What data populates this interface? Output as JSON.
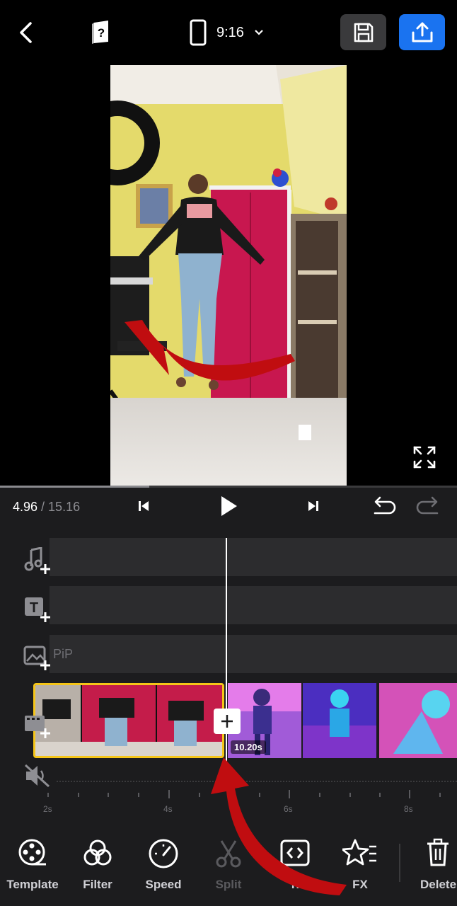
{
  "topbar": {
    "back_icon": "back-arrow-icon",
    "help_icon": "help-book-icon",
    "aspect_ratio": "9:16",
    "save_icon": "save-icon",
    "export_icon": "export-upload-icon",
    "export_color": "#1a73f0"
  },
  "preview": {
    "fullscreen_icon": "fullscreen-icon",
    "annotation_arrow_color": "#c00d10"
  },
  "playback": {
    "current_time": "4.96",
    "separator_total": " / 15.16",
    "progress": 0.327
  },
  "tracks": {
    "pip_label": "PiP",
    "video_clip_duration": "10.20s"
  },
  "ruler": [
    "2s",
    "4s",
    "6s",
    "8s"
  ],
  "toolbar": {
    "items": [
      {
        "label": "Template",
        "icon": "template-reel-icon"
      },
      {
        "label": "Filter",
        "icon": "filter-circles-icon"
      },
      {
        "label": "Speed",
        "icon": "speedometer-icon"
      },
      {
        "label": "Split",
        "icon": "scissors-icon"
      },
      {
        "label": "Tr",
        "icon": "trim-brackets-icon"
      },
      {
        "label": "FX",
        "icon": "fx-star-icon"
      },
      {
        "label": "Delete",
        "icon": "trash-icon"
      }
    ]
  }
}
